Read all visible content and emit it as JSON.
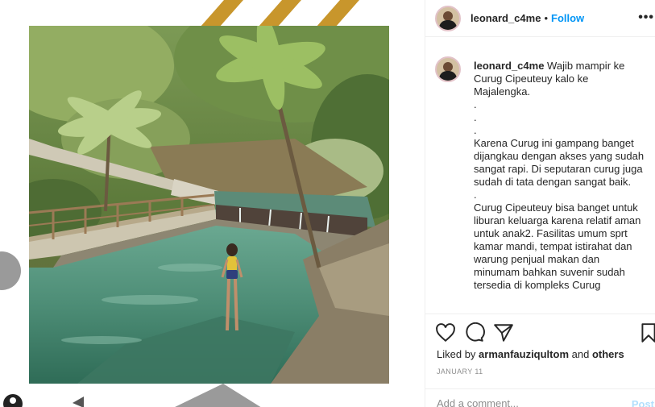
{
  "post": {
    "username": "leonard_c4me",
    "separator": "•",
    "follow_label": "Follow",
    "more_icon": "more-options-icon",
    "more_label": "•••"
  },
  "caption": {
    "username": "leonard_c4me",
    "text": " Wajib mampir ke Curug Cipeuteuy kalo ke Majalengka.\n.\n.\n.\nKarena Curug ini gampang banget dijangkau dengan akses yang sudah sangat rapi. Di seputaran curug juga sudah di tata dengan sangat baik.\n.\nCurug Cipeuteuy bisa banget untuk liburan keluarga karena relatif aman untuk anak2. Fasilitas umum sprt kamar mandi, tempat istirahat dan warung penjual makan dan minumam bahkan suvenir sudah tersedia di kompleks Curug"
  },
  "actions": {
    "like_icon": "heart-icon",
    "comment_icon": "comment-icon",
    "share_icon": "paper-plane-icon",
    "save_icon": "bookmark-icon"
  },
  "likes": {
    "prefix": "Liked by ",
    "user": "armanfauziqultom",
    "middle": " and ",
    "others": "others"
  },
  "date": "JANUARY 11",
  "comment_box": {
    "placeholder": "Add a comment...",
    "post_label": "Post"
  },
  "colors": {
    "accent": "#0095f6",
    "text": "#262626",
    "muted": "#8e8e8e",
    "post_disabled": "#b2dffc",
    "deco_stripe": "#c8962c"
  }
}
